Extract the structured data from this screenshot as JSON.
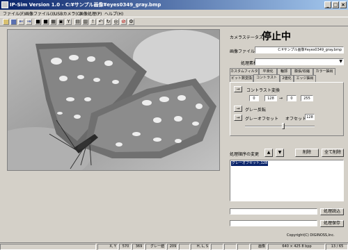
{
  "window": {
    "title": "IP-Sim Version 1.0  -  C:¥サンプル画像¥eyes0349_gray.bmp"
  },
  "menu": [
    "ファイル(F)",
    "画像ファイル(I)",
    "USBカメラ(C)",
    "画像処理(P)",
    "ヘルプ(H)"
  ],
  "status": {
    "label": "カメラステータス",
    "value": "停止中"
  },
  "image_file": {
    "label": "画像ファイル名",
    "value": "C:¥サンプル画像¥eyes0349_gray.bmp"
  },
  "process_category": {
    "label": "処理素材",
    "value": ""
  },
  "tabs_row1": [
    "カスタムフィルター",
    "平滑化",
    "輪郭",
    "膨張/収縮",
    "カラー抽出"
  ],
  "tabs_row2": [
    "ビット数変換",
    "コントラスト",
    "2値化",
    "エッジ抽出"
  ],
  "contrast": {
    "button_label": "→",
    "title": "コントラスト変換",
    "in_low": "0",
    "in_high": "128",
    "arrow": "→",
    "out_low": "0",
    "out_high": "255"
  },
  "grey_invert": {
    "button_label": "→",
    "label": "グレー反転"
  },
  "grey_offset": {
    "button_label": "→",
    "label": "グレーオフセット",
    "offset_label": "オフセット",
    "offset_value": "128",
    "slider_level": 0.55
  },
  "process_order": {
    "label": "処理順序の変更",
    "up": "▲",
    "down": "▼",
    "delete_label": "削除",
    "delete_all_label": "全て削除"
  },
  "process_list": {
    "items": [
      "グレーオフセット,128"
    ]
  },
  "load_label": "処理読込",
  "save_label": "処理保存",
  "copyright": "Copyright(C) DIGINOSS,Inc.",
  "statusbar": {
    "xy_label": "X, Y",
    "x_value": "570",
    "y_value": "369",
    "gray_label": "グレー値",
    "gray_value": "209",
    "hls_label": "H, L, S",
    "image_label": "画像",
    "image_size": "640 × 425  8 bpp",
    "zoom": "13 / 65"
  },
  "colors": {
    "titlebar_start": "#0a246a",
    "titlebar_end": "#a6caf0",
    "face": "#d4d0c8",
    "selected": "#0a246a"
  }
}
